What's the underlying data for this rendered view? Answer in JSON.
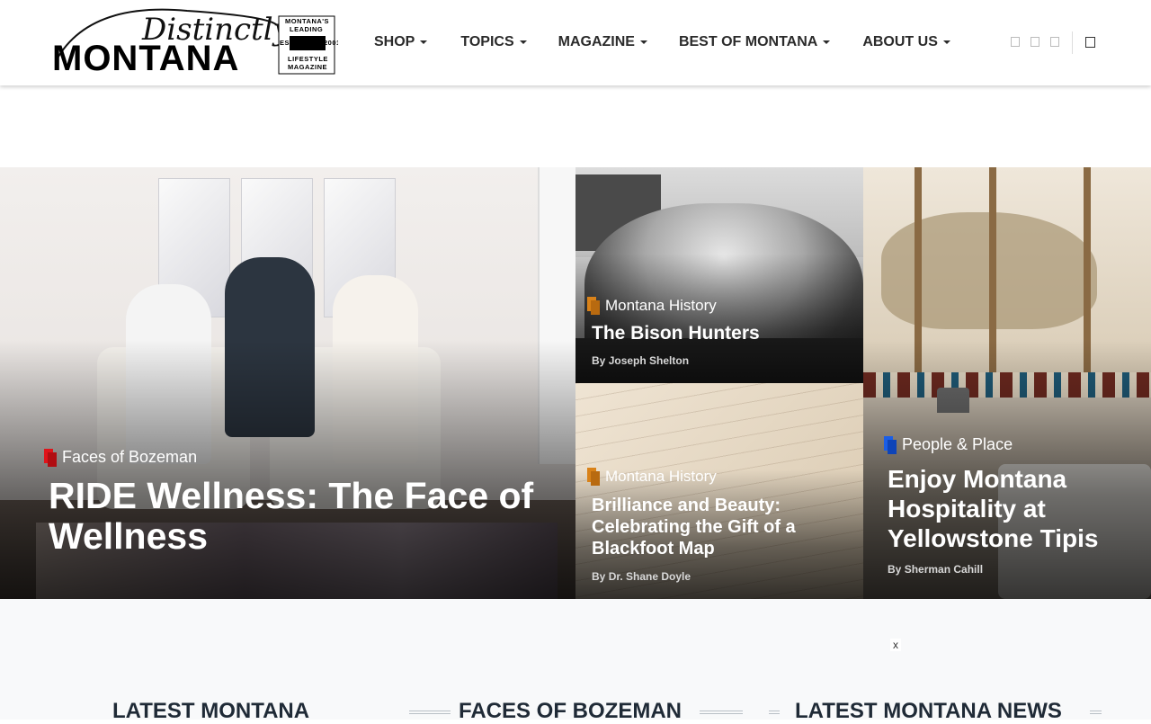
{
  "logo": {
    "script_word": "Distinctly",
    "main_word": "MONTANA",
    "badge_top": "MONTANA'S",
    "badge_leading": "LEADING",
    "badge_est": "EST.",
    "badge_year": "2001",
    "badge_lifestyle": "LIFESTYLE",
    "badge_magazine": "MAGAZINE"
  },
  "nav": {
    "items": [
      {
        "label": "SHOP"
      },
      {
        "label": "TOPICS"
      },
      {
        "label": "MAGAZINE"
      },
      {
        "label": "BEST OF MONTANA"
      },
      {
        "label": "ABOUT US"
      }
    ]
  },
  "header_icons": [
    "social-icon-1",
    "social-icon-2",
    "social-icon-3",
    "search-icon"
  ],
  "hero": {
    "main": {
      "category": "Faces of Bozeman",
      "category_color": "#e0131a",
      "title": "RIDE Wellness: The Face of Wellness"
    },
    "top_middle": {
      "category": "Montana History",
      "category_color": "#d98219",
      "title": "The Bison Hunters",
      "byline_prefix": "By",
      "author": "Joseph Shelton"
    },
    "bottom_middle": {
      "category": "Montana History",
      "category_color": "#d98219",
      "title": "Brilliance and Beauty: Celebrating the Gift of a Blackfoot Map",
      "byline_prefix": "By",
      "author": "Dr. Shane Doyle"
    },
    "right": {
      "category": "People & Place",
      "category_color": "#1a5ee6",
      "title": "Enjoy Montana Hospitality at Yellowstone Tipis",
      "byline_prefix": "By",
      "author": "Sherman Cahill"
    }
  },
  "ad_close": "x",
  "sections": {
    "left": "LATEST MONTANA",
    "center": "FACES OF BOZEMAN",
    "right": "LATEST MONTANA NEWS"
  }
}
